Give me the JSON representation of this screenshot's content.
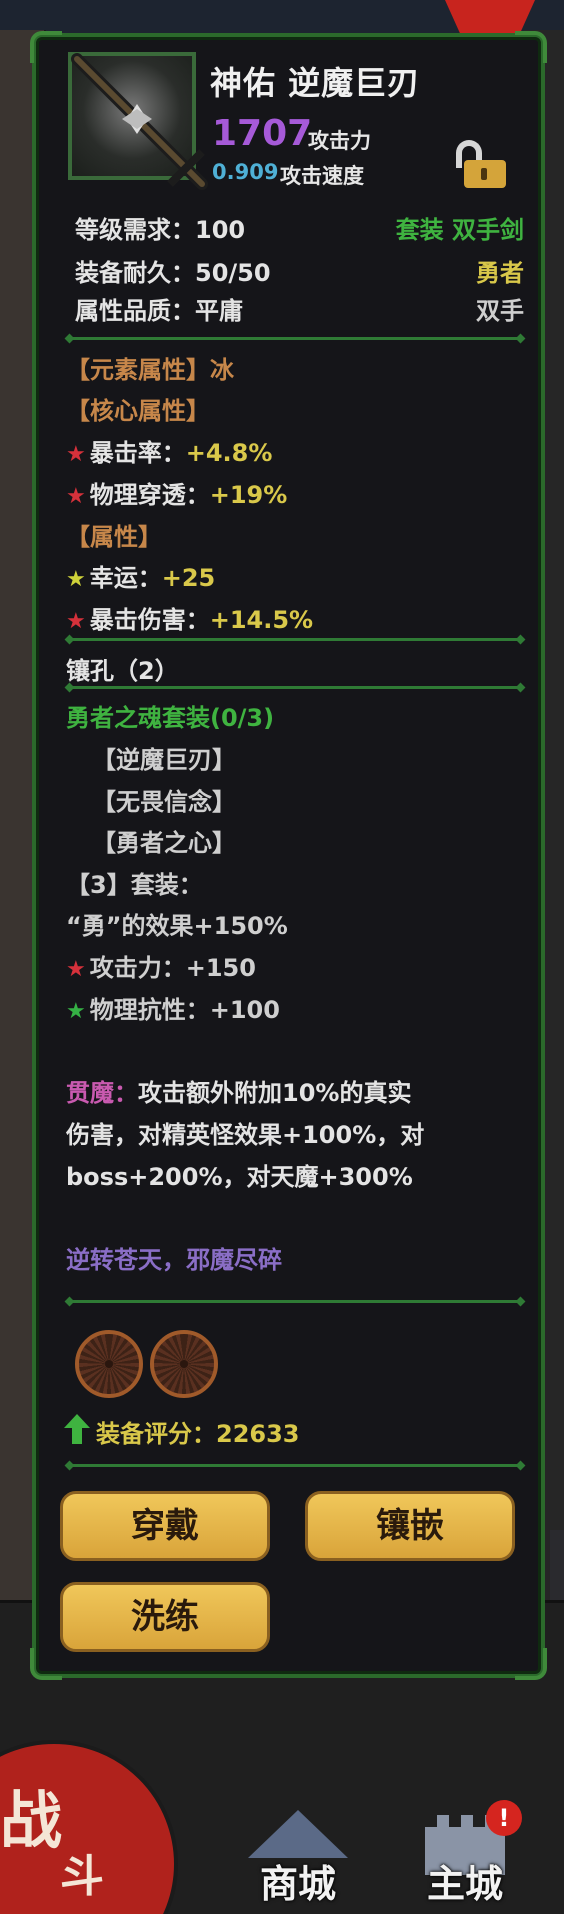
{
  "item": {
    "name": "神佑 逆魔巨刃",
    "attack_value": "1707",
    "attack_label": "攻击力",
    "speed_value": "0.909",
    "speed_label": "攻击速度"
  },
  "basic": {
    "level_req": "等级需求：100",
    "durability": "装备耐久：50/50",
    "quality": "属性品质：平庸",
    "type_set": "套装 双手剑",
    "class": "勇者",
    "hand": "双手"
  },
  "element": {
    "header": "【元素属性】冰"
  },
  "core": {
    "header": "【核心属性】",
    "lines": [
      "暴击率：",
      "物理穿透："
    ],
    "values": [
      "+4.8%",
      "+19%"
    ]
  },
  "attrs": {
    "header": "【属性】",
    "lines": [
      "幸运：",
      "暴击伤害："
    ],
    "values": [
      "+25",
      "+14.5%"
    ]
  },
  "sockets": {
    "label": "镶孔（2）"
  },
  "set": {
    "title": "勇者之魂套装(0/3)",
    "pieces": [
      "【逆魔巨刃】",
      "【无畏信念】",
      "【勇者之心】"
    ],
    "bonus_header": "【3】套装：",
    "bonus_lines": [
      "“勇”的效果+150%",
      "攻击力：+150",
      "物理抗性：+100"
    ]
  },
  "special": {
    "name": "贯魔：",
    "line1": "攻击额外附加10%的真实",
    "line2": "伤害，对精英怪效果+100%，对",
    "line3": "boss+200%，对天魔+300%"
  },
  "flavor": "逆转苍天，邪魔尽碎",
  "score": {
    "label": "装备评分：22633"
  },
  "buttons": {
    "equip": "穿戴",
    "inlay": "镶嵌",
    "refine": "洗练"
  },
  "nav": {
    "shop": "商城",
    "main_city": "主城",
    "battle1": "战",
    "battle2": "斗",
    "badge": "!"
  },
  "colors": {
    "panel_border": "#2b6a2b",
    "attack_purple": "#a65ad8",
    "speed_blue": "#4fb0d6",
    "set_green": "#3fb340",
    "bonus_yellow": "#d9c84a",
    "section_orange": "#c7874a",
    "button_gold": "#e6b64a"
  }
}
